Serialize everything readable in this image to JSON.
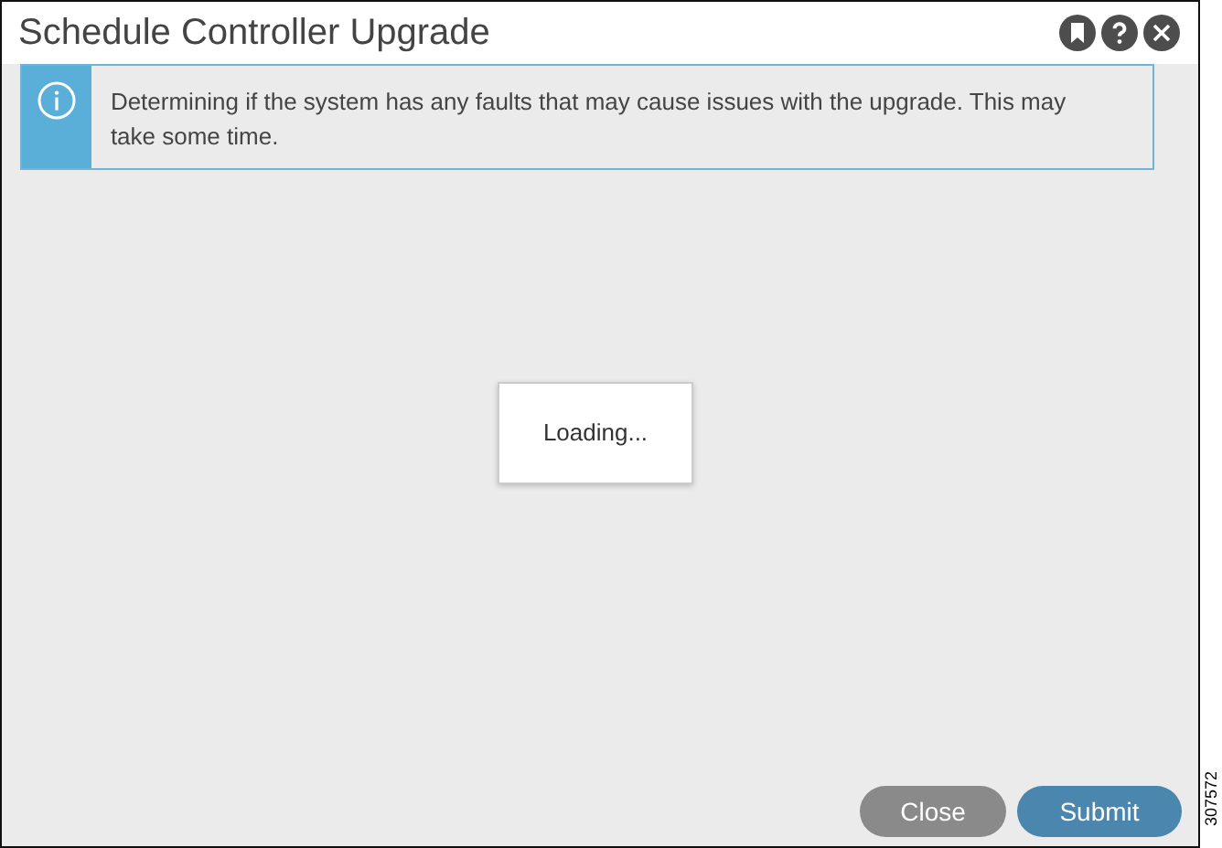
{
  "window": {
    "title": "Schedule Controller Upgrade"
  },
  "info": {
    "message": "Determining if the system has any faults that may cause issues with the upgrade. This may take some time."
  },
  "loading": {
    "text": "Loading..."
  },
  "buttons": [
    {
      "label": "Close",
      "kind": "secondary"
    },
    {
      "label": "Submit",
      "kind": "primary"
    }
  ],
  "figure_number": "307572"
}
